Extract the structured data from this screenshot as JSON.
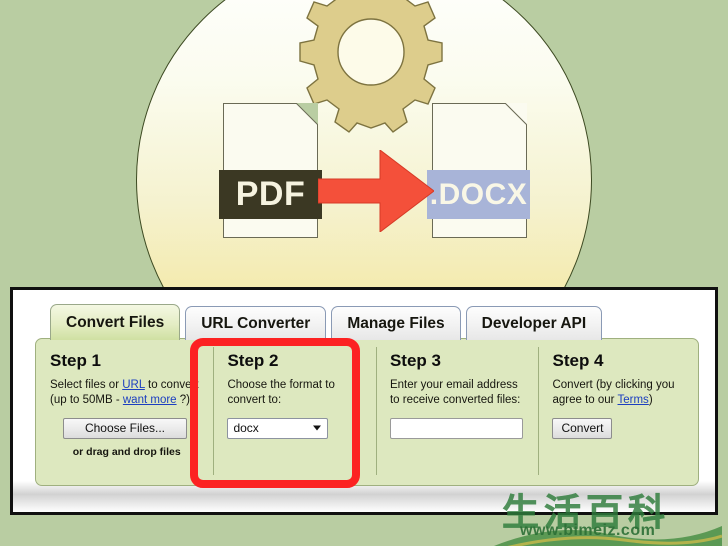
{
  "illustration": {
    "source_label": "PDF",
    "target_label": ".DOCX",
    "gear_icon": "gear-icon",
    "arrow_icon": "right-arrow-icon",
    "colors": {
      "background": "#b9cda2",
      "circle_top": "#ffffff",
      "circle_bottom": "#f2e08a",
      "gear": "#ddcd8c",
      "arrow": "#f4503a",
      "pdf_label_bg": "#3b3823",
      "docx_label_bg": "#a8b4d8"
    }
  },
  "panel": {
    "tabs": [
      {
        "label": "Convert Files",
        "active": true
      },
      {
        "label": "URL Converter",
        "active": false
      },
      {
        "label": "Manage Files",
        "active": false
      },
      {
        "label": "Developer API",
        "active": false
      }
    ],
    "steps": [
      {
        "title": "Step 1",
        "desc_part1": "Select files or ",
        "link1": "URL",
        "desc_part2": " to convert (up to 50MB - ",
        "link2": "want more",
        "desc_part3": " ?)",
        "button_label": "Choose Files...",
        "note": "or drag and drop files"
      },
      {
        "title": "Step 2",
        "desc": "Choose the format to convert to:",
        "select_value": "docx",
        "select_options": [
          "docx"
        ]
      },
      {
        "title": "Step 3",
        "desc": "Enter your email address to receive converted files:",
        "input_value": "",
        "input_placeholder": ""
      },
      {
        "title": "Step 4",
        "desc_part1": "Convert (by clicking you agree to our ",
        "link1": "Terms",
        "desc_part2": ")",
        "button_label": "Convert"
      }
    ],
    "highlight": {
      "target": "step-2",
      "color": "#fc2222"
    }
  },
  "watermark": {
    "text_cn": "生活百科",
    "url": "www.bimeiz.com",
    "color": "#2f7d3c"
  }
}
